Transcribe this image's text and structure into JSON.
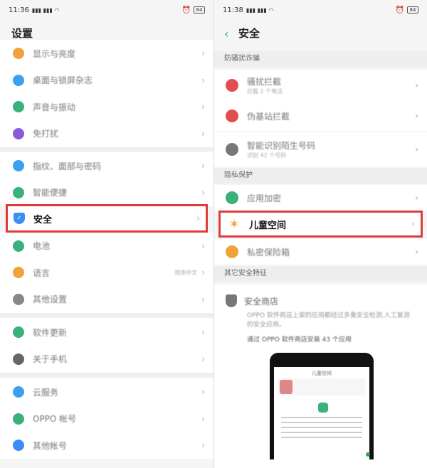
{
  "left": {
    "status": {
      "time": "11:36",
      "signal": "5Gᵢᵢ 5Gᵢᵢ",
      "battery": "84"
    },
    "title": "设置",
    "items_top": [
      {
        "label": "显示与亮度",
        "icon": "sun-icon",
        "color": "#f2a23a"
      },
      {
        "label": "桌面与锁屏杂志",
        "icon": "desktop-icon",
        "color": "#3aa0f2"
      },
      {
        "label": "声音与振动",
        "icon": "sound-icon",
        "color": "#3ab07a"
      },
      {
        "label": "免打扰",
        "icon": "moon-icon",
        "color": "#8a5ad8"
      }
    ],
    "items_mid": [
      {
        "label": "指纹、面部与密码",
        "icon": "fingerprint-icon",
        "color": "#3aa0f2"
      },
      {
        "label": "智能便捷",
        "icon": "smart-icon",
        "color": "#3ab07a"
      },
      {
        "label": "安全",
        "icon": "shield-icon",
        "color": "#3a8df2"
      },
      {
        "label": "电池",
        "icon": "battery-icon",
        "color": "#3ab07a"
      },
      {
        "label": "语言",
        "icon": "language-icon",
        "color": "#f2a23a",
        "value": "简体中文"
      },
      {
        "label": "其他设置",
        "icon": "gear-icon",
        "color": "#888888"
      }
    ],
    "items_low": [
      {
        "label": "软件更新",
        "icon": "update-icon",
        "color": "#3ab07a"
      },
      {
        "label": "关于手机",
        "icon": "info-icon",
        "color": "#666666"
      }
    ],
    "items_acct": [
      {
        "label": "云服务",
        "icon": "cloud-icon",
        "color": "#3aa0f2"
      },
      {
        "label": "OPPO 帐号",
        "icon": "user-icon",
        "color": "#3ab07a"
      },
      {
        "label": "其他帐号",
        "icon": "user-icon",
        "color": "#3a8df2"
      }
    ]
  },
  "right": {
    "status": {
      "time": "11:38",
      "battery": "84"
    },
    "title": "安全",
    "sections": {
      "fraud": "防骚扰诈骗",
      "privacy": "隐私保护",
      "other": "其它安全特征"
    },
    "fraud_items": [
      {
        "label": "骚扰拦截",
        "sub": "拦截 2 个电话",
        "icon": "block-icon",
        "color": "#e05050"
      },
      {
        "label": "伪基站拦截",
        "sub": "",
        "icon": "antenna-icon",
        "color": "#e05050"
      },
      {
        "label": "智能识别陌生号码",
        "sub": "识别 42 个号码",
        "icon": "person-icon",
        "color": "#777777"
      }
    ],
    "privacy_items": [
      {
        "label": "应用加密",
        "icon": "lock-icon",
        "color": "#3ab07a"
      },
      {
        "label": "儿童空间",
        "icon": "child-icon",
        "color": "#f2a23a"
      },
      {
        "label": "私密保险箱",
        "icon": "folder-icon",
        "color": "#f2a23a"
      }
    ],
    "store": {
      "name": "安全商店",
      "desc": "OPPO 软件商店上架的应用都经过多重安全检测,人工复测的安全应用。",
      "count": "通过 OPPO 软件商店安装 43 个应用",
      "phone_title": "儿童空间"
    }
  }
}
